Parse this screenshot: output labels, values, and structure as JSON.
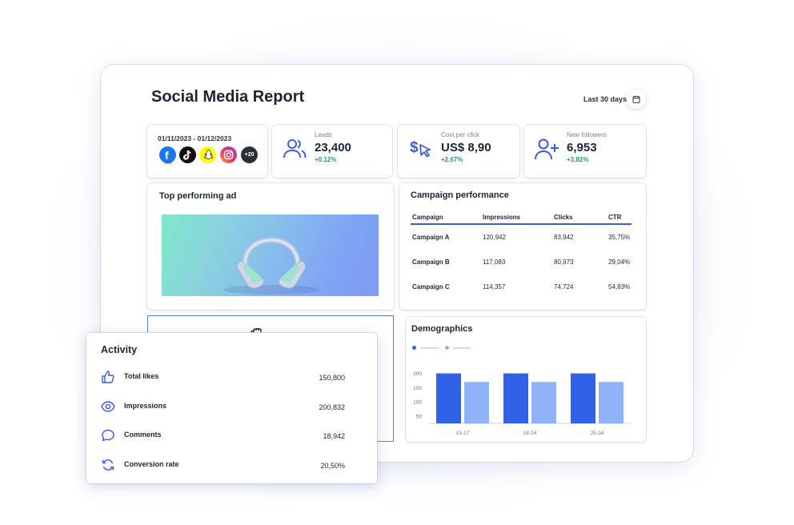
{
  "header": {
    "title": "Social Media Report",
    "date_range_label": "Last 30 days"
  },
  "overview": {
    "period": "01/11/2023 - 01/12/2023",
    "platforms": [
      "facebook",
      "tiktok",
      "snapchat",
      "instagram"
    ],
    "facebook_sub": "(All)",
    "more_count": "+20"
  },
  "kpis": [
    {
      "label": "Leads",
      "value": "23,400",
      "delta": "+0.12%",
      "icon": "users-icon"
    },
    {
      "label": "Cost per click",
      "value": "US$ 8,90",
      "delta": "+2.67%",
      "icon": "dollar-cursor-icon"
    },
    {
      "label": "New followers",
      "value": "6,953",
      "delta": "+3.82%",
      "icon": "user-plus-icon"
    }
  ],
  "top_ad": {
    "title": "Top performing ad",
    "image": "headphones-image"
  },
  "campaign": {
    "title": "Campaign performance",
    "columns": [
      "Campaign",
      "Impressions",
      "Clicks",
      "CTR"
    ],
    "rows": [
      [
        "Campaign A",
        "120,942",
        "83,942",
        "35,75%"
      ],
      [
        "Campaign B",
        "117,083",
        "80,973",
        "29,04%"
      ],
      [
        "Campaign C",
        "114,357",
        "74,724",
        "54,83%"
      ]
    ]
  },
  "activity": {
    "title": "Activity",
    "items": [
      {
        "label": "Total likes",
        "value": "150,800",
        "icon": "thumbs-up-icon"
      },
      {
        "label": "Impressions",
        "value": "200,832",
        "icon": "eye-icon"
      },
      {
        "label": "Comments",
        "value": "18,942",
        "icon": "comment-icon"
      },
      {
        "label": "Conversion rate",
        "value": "20,50%",
        "icon": "refresh-icon"
      }
    ]
  },
  "demographics": {
    "title": "Demographics"
  },
  "colors": {
    "accent": "#3b5bdb",
    "positive": "#1f9d6b",
    "bar_primary": "#2f62e8",
    "bar_secondary": "#8fb1f6"
  },
  "chart_data": {
    "type": "bar",
    "title": "Demographics",
    "categories": [
      "13-17",
      "18-24",
      "25-34"
    ],
    "series": [
      {
        "values": [
          200,
          200,
          200
        ]
      },
      {
        "values": [
          170,
          170,
          170
        ]
      }
    ],
    "yticks": [
      50,
      100,
      150,
      200
    ],
    "ylim": [
      25,
      210
    ],
    "xlabel": "",
    "ylabel": "",
    "grid": false,
    "legend": "top-left"
  }
}
